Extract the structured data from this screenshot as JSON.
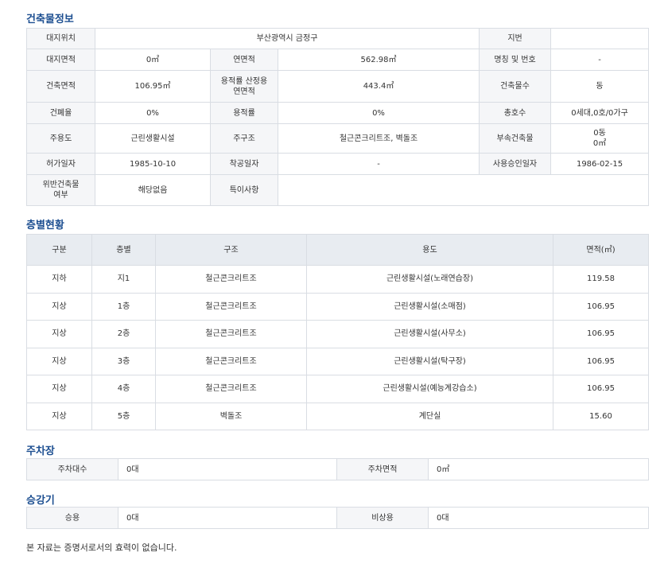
{
  "building": {
    "title": "건축물정보",
    "rows": [
      [
        {
          "t": "대지위치",
          "l": 1
        },
        {
          "t": "부산광역시 금정구",
          "cs": 3
        },
        {
          "t": "지번",
          "l": 1
        },
        {
          "t": ""
        }
      ],
      [
        {
          "t": "대지면적",
          "l": 1
        },
        {
          "t": "0㎡"
        },
        {
          "t": "연면적",
          "l": 1
        },
        {
          "t": "562.98㎡"
        },
        {
          "t": "명칭 및 번호",
          "l": 1
        },
        {
          "t": "-"
        }
      ],
      [
        {
          "t": "건축면적",
          "l": 1
        },
        {
          "t": "106.95㎡"
        },
        {
          "t": "용적률 산정용\n연면적",
          "l": 1
        },
        {
          "t": "443.4㎡"
        },
        {
          "t": "건축물수",
          "l": 1
        },
        {
          "t": "동"
        }
      ],
      [
        {
          "t": "건폐율",
          "l": 1
        },
        {
          "t": "0%"
        },
        {
          "t": "용적률",
          "l": 1
        },
        {
          "t": "0%"
        },
        {
          "t": "총호수",
          "l": 1
        },
        {
          "t": "0세대,0호/0가구"
        }
      ],
      [
        {
          "t": "주용도",
          "l": 1
        },
        {
          "t": "근린생활시설"
        },
        {
          "t": "주구조",
          "l": 1
        },
        {
          "t": "철근콘크리트조, 벽돌조"
        },
        {
          "t": "부속건축물",
          "l": 1
        },
        {
          "t": "0동\n0㎡"
        }
      ],
      [
        {
          "t": "허가일자",
          "l": 1
        },
        {
          "t": "1985-10-10"
        },
        {
          "t": "착공일자",
          "l": 1
        },
        {
          "t": "-"
        },
        {
          "t": "사용승인일자",
          "l": 1
        },
        {
          "t": "1986-02-15"
        }
      ],
      [
        {
          "t": "위반건축물\n여부",
          "l": 1
        },
        {
          "t": "해당없음"
        },
        {
          "t": "특이사항",
          "l": 1
        },
        {
          "t": "",
          "cs": 3
        }
      ]
    ]
  },
  "floors": {
    "title": "층별현황",
    "headers": [
      "구분",
      "층별",
      "구조",
      "용도",
      "면적(㎡)"
    ],
    "rows": [
      [
        "지하",
        "지1",
        "철근콘크리트조",
        "근린생활시설(노래연습장)",
        "119.58"
      ],
      [
        "지상",
        "1층",
        "철근콘크리트조",
        "근린생활시설(소매점)",
        "106.95"
      ],
      [
        "지상",
        "2층",
        "철근콘크리트조",
        "근린생활시설(사무소)",
        "106.95"
      ],
      [
        "지상",
        "3층",
        "철근콘크리트조",
        "근린생활시설(탁구장)",
        "106.95"
      ],
      [
        "지상",
        "4층",
        "철근콘크리트조",
        "근린생활시설(예능계강습소)",
        "106.95"
      ],
      [
        "지상",
        "5층",
        "벽돌조",
        "계단실",
        "15.60"
      ]
    ]
  },
  "parking": {
    "title": "주차장",
    "count_label": "주차대수",
    "count_value": "0대",
    "area_label": "주차면적",
    "area_value": "0㎡"
  },
  "elevator": {
    "title": "승강기",
    "passenger_label": "승용",
    "passenger_value": "0대",
    "emergency_label": "비상용",
    "emergency_value": "0대"
  },
  "disclaimer": "본 자료는 증명서로서의 효력이 없습니다."
}
